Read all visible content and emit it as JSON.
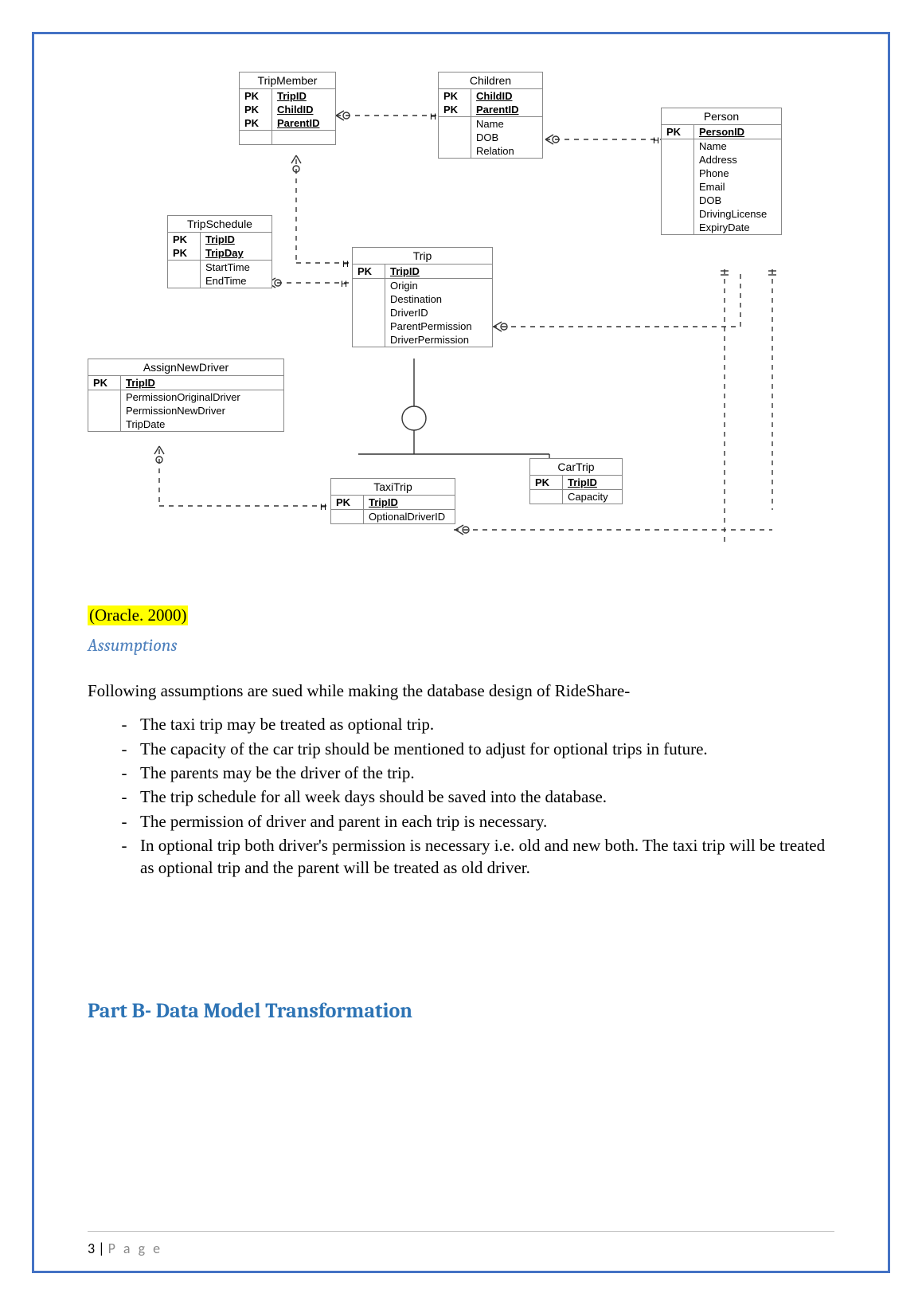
{
  "diagram": {
    "entities": {
      "tripmember": {
        "title": "TripMember",
        "rows": [
          {
            "pk": "PK",
            "name": "TripID",
            "underline": true
          },
          {
            "pk": "PK",
            "name": "ChildID",
            "underline": true
          },
          {
            "pk": "PK",
            "name": "ParentID",
            "underline": true
          }
        ],
        "body": []
      },
      "children": {
        "title": "Children",
        "rows": [
          {
            "pk": "PK",
            "name": "ChildID",
            "underline": true
          },
          {
            "pk": "PK",
            "name": "ParentID",
            "underline": true
          }
        ],
        "body": [
          "Name",
          "DOB",
          "Relation"
        ]
      },
      "person": {
        "title": "Person",
        "rows": [
          {
            "pk": "PK",
            "name": "PersonID",
            "underline": true
          }
        ],
        "body": [
          "Name",
          "Address",
          "Phone",
          "Email",
          "DOB",
          "DrivingLicense",
          "ExpiryDate"
        ]
      },
      "tripschedule": {
        "title": "TripSchedule",
        "rows": [
          {
            "pk": "PK",
            "name": "TripID",
            "underline": true
          },
          {
            "pk": "PK",
            "name": "TripDay",
            "underline": true
          }
        ],
        "body": [
          "StartTime",
          "EndTime"
        ]
      },
      "trip": {
        "title": "Trip",
        "rows": [
          {
            "pk": "PK",
            "name": "TripID",
            "underline": true
          }
        ],
        "body": [
          "Origin",
          "Destination",
          "DriverID",
          "ParentPermission",
          "DriverPermission"
        ]
      },
      "assignnewdriver": {
        "title": "AssignNewDriver",
        "rows": [
          {
            "pk": "PK",
            "name": "TripID",
            "underline": true
          }
        ],
        "body": [
          "PermissionOriginalDriver",
          "PermissionNewDriver",
          "TripDate"
        ]
      },
      "taxitrip": {
        "title": "TaxiTrip",
        "rows": [
          {
            "pk": "PK",
            "name": "TripID",
            "underline": true
          }
        ],
        "body": [
          "OptionalDriverID"
        ]
      },
      "cartrip": {
        "title": "CarTrip",
        "rows": [
          {
            "pk": "PK",
            "name": "TripID",
            "underline": true
          }
        ],
        "body": [
          "Capacity"
        ]
      }
    }
  },
  "citation": "(Oracle. 2000)",
  "assumptions_heading": "Assumptions",
  "intro": "Following assumptions are sued while making the database design of RideShare-",
  "bullets": [
    "The taxi trip may be treated as optional trip.",
    "The capacity of the car trip should be mentioned to adjust for optional trips in future.",
    "The parents may be the driver of the trip.",
    "The trip schedule for all week days should be saved into the database.",
    "The permission of driver and parent in each trip is necessary.",
    "In optional trip both driver's permission is necessary i.e. old and new both. The taxi trip will be treated as optional trip and the parent will be treated as old driver."
  ],
  "partb": "Part B- Data Model Transformation",
  "footer": {
    "num": "3",
    "sep": " | ",
    "label": "P a g e"
  }
}
